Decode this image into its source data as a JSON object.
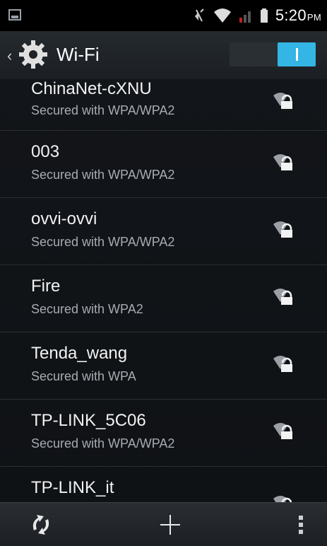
{
  "statusbar": {
    "time": "5:20",
    "ampm": "PM",
    "icons": [
      "screenshot-icon",
      "mute-icon",
      "wifi-icon",
      "signal-icon",
      "battery-icon"
    ]
  },
  "actionbar": {
    "title": "Wi-Fi",
    "icon": "settings-gear-icon",
    "toggle_state": "on",
    "accent": "#33b5e5"
  },
  "networks": [
    {
      "ssid": "ChinaNet-cXNU",
      "security": "Secured with WPA/WPA2"
    },
    {
      "ssid": "003",
      "security": "Secured with WPA/WPA2"
    },
    {
      "ssid": "ovvi-ovvi",
      "security": "Secured with WPA/WPA2"
    },
    {
      "ssid": "Fire",
      "security": "Secured with WPA2"
    },
    {
      "ssid": "Tenda_wang",
      "security": "Secured with WPA"
    },
    {
      "ssid": "TP-LINK_5C06",
      "security": "Secured with WPA/WPA2"
    },
    {
      "ssid": "TP-LINK_it",
      "security": ""
    }
  ],
  "bottombar": {
    "buttons": [
      "wps-refresh-icon",
      "add-network-icon",
      "overflow-menu-icon"
    ]
  }
}
